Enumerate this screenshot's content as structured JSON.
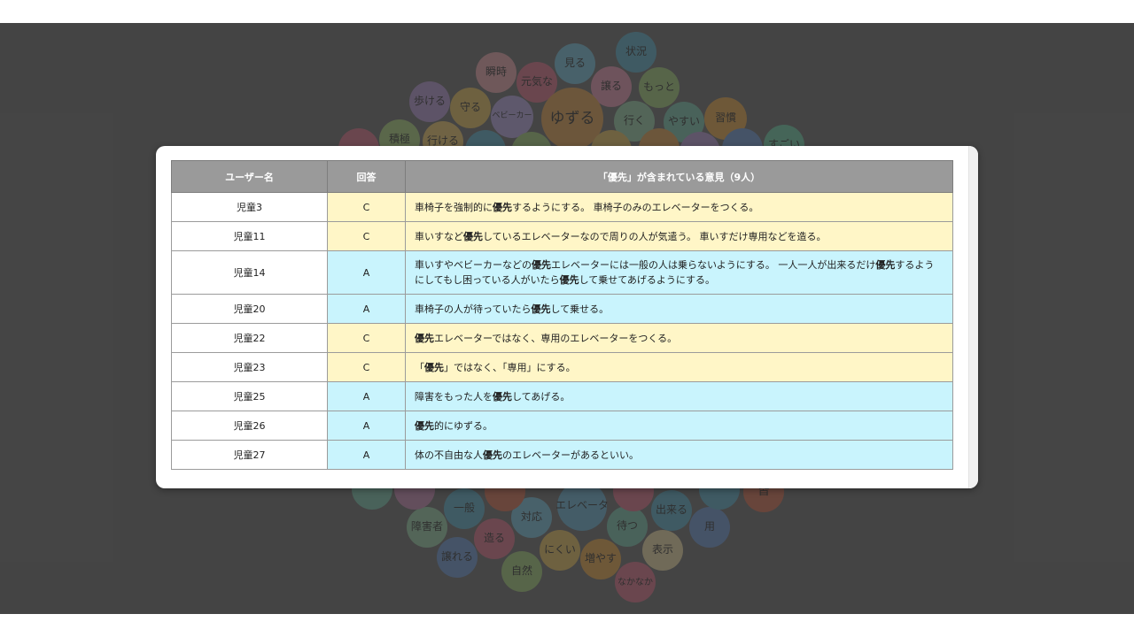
{
  "table": {
    "headers": {
      "user": "ユーザー名",
      "answer": "回答",
      "opinion": "「優先」が含まれている意見（9人）"
    },
    "keyword": "優先",
    "rows": [
      {
        "user": "児童3",
        "answer": "C",
        "text": "車椅子を強制的に優先するようにする。 車椅子のみのエレベーターをつくる。"
      },
      {
        "user": "児童11",
        "answer": "C",
        "text": "車いすなど優先しているエレベーターなので周りの人が気遣う。 車いすだけ専用などを造る。"
      },
      {
        "user": "児童14",
        "answer": "A",
        "text": "車いすやベビーカーなどの優先エレベーターには一般の人は乗らないようにする。 一人一人が出来るだけ優先するようにしてもし困っている人がいたら優先して乗せてあげるようにする。"
      },
      {
        "user": "児童20",
        "answer": "A",
        "text": "車椅子の人が待っていたら優先して乗せる。"
      },
      {
        "user": "児童22",
        "answer": "C",
        "text": "優先エレベーターではなく、専用のエレベーターをつくる。"
      },
      {
        "user": "児童23",
        "answer": "C",
        "text": "「優先」ではなく、「専用」にする。"
      },
      {
        "user": "児童25",
        "answer": "A",
        "text": "障害をもった人を優先してあげる。"
      },
      {
        "user": "児童26",
        "answer": "A",
        "text": "優先的にゆずる。"
      },
      {
        "user": "児童27",
        "answer": "A",
        "text": "体の不自由な人優先のエレベーターがあるといい。"
      }
    ]
  },
  "word_cloud": {
    "colors": [
      "#e0607e",
      "#4aa8c8",
      "#9fd06c",
      "#f1c04e",
      "#e89a3c",
      "#b58fd8",
      "#5f8fd6",
      "#6cc4a8",
      "#c97fb0",
      "#d95f3a"
    ],
    "words": [
      {
        "text": "状況",
        "color": "#4aa8c8"
      },
      {
        "text": "瞬時",
        "color": "#f2a0a8"
      },
      {
        "text": "見る",
        "color": "#6ac0e0"
      },
      {
        "text": "元気な",
        "color": "#e0607e"
      },
      {
        "text": "譲る",
        "color": "#f08fb0"
      },
      {
        "text": "もっと",
        "color": "#9fd06c"
      },
      {
        "text": "歩ける",
        "color": "#b58fd8"
      },
      {
        "text": "守る",
        "color": "#f1c04e"
      },
      {
        "text": "ベビーカー",
        "color": "#b8a0e8"
      },
      {
        "text": "ゆずる",
        "color": "#e89a3c"
      },
      {
        "text": "行く",
        "color": "#8fd0a0"
      },
      {
        "text": "やすい",
        "color": "#6cc4a8"
      },
      {
        "text": "習慣",
        "color": "#f0a030"
      },
      {
        "text": "積極",
        "color": "#a8d870"
      },
      {
        "text": "行ける",
        "color": "#f6c85a"
      },
      {
        "text": "すごい",
        "color": "#5fd0a0"
      },
      {
        "text": "一般",
        "color": "#4aa8c8"
      },
      {
        "text": "障害者",
        "color": "#8fd0a0"
      },
      {
        "text": "対応",
        "color": "#6ac0e0"
      },
      {
        "text": "エレベータ",
        "color": "#5ab0d8"
      },
      {
        "text": "待つ",
        "color": "#6cc4a8"
      },
      {
        "text": "出来る",
        "color": "#4aa8c8"
      },
      {
        "text": "用",
        "color": "#5f8fd6"
      },
      {
        "text": "造る",
        "color": "#e0607e"
      },
      {
        "text": "譲れる",
        "color": "#5f8fd6"
      },
      {
        "text": "にくい",
        "color": "#f1c04e"
      },
      {
        "text": "増やす",
        "color": "#f0a030"
      },
      {
        "text": "表示",
        "color": "#f6e0a0"
      },
      {
        "text": "自然",
        "color": "#9fd06c"
      },
      {
        "text": "なかなか",
        "color": "#e0607e"
      },
      {
        "text": "皆",
        "color": "#d95f3a"
      }
    ]
  }
}
